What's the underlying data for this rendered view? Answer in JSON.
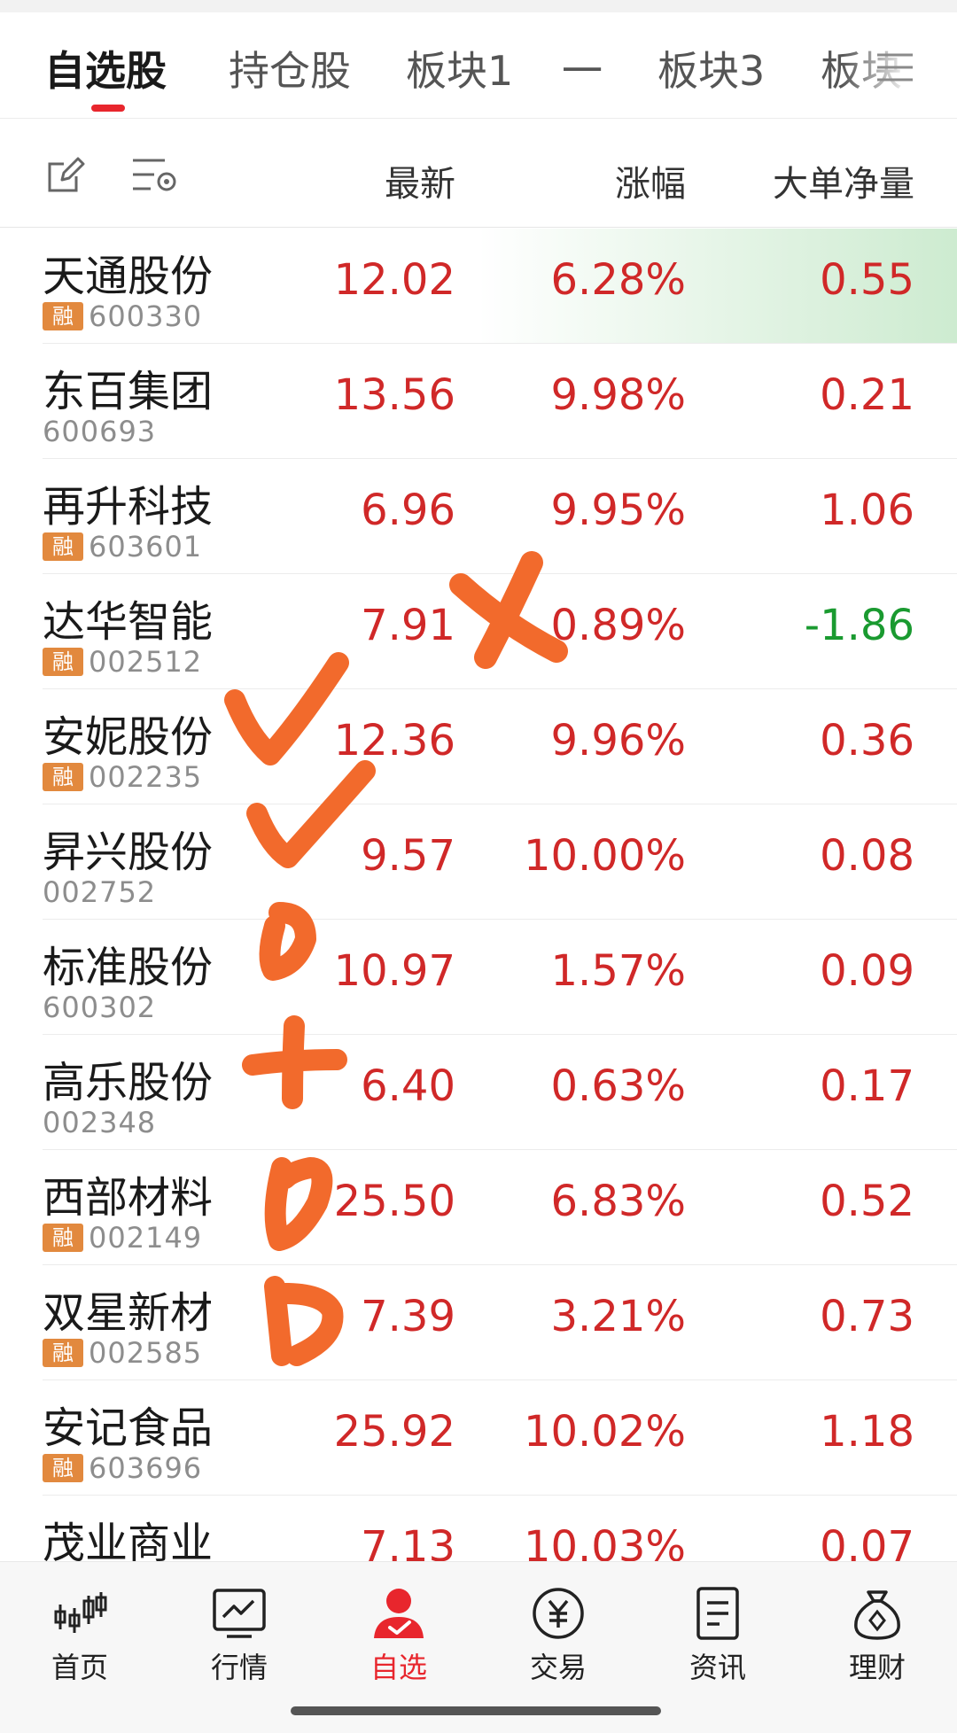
{
  "tabs": [
    {
      "label": "自选股",
      "active": true
    },
    {
      "label": "持仓股"
    },
    {
      "label": "板块1"
    },
    {
      "label": "一"
    },
    {
      "label": "板块3"
    },
    {
      "label": "板块"
    }
  ],
  "header": {
    "col_price": "最新",
    "col_change": "涨幅",
    "col_netflow": "大单净量"
  },
  "badge_label": "融",
  "stocks": [
    {
      "name": "天通股份",
      "code": "600330",
      "margin": true,
      "price": "12.02",
      "change": "6.28%",
      "netflow": "0.55",
      "highlighted": true
    },
    {
      "name": "东百集团",
      "code": "600693",
      "margin": false,
      "price": "13.56",
      "change": "9.98%",
      "netflow": "0.21"
    },
    {
      "name": "再升科技",
      "code": "603601",
      "margin": true,
      "price": "6.96",
      "change": "9.95%",
      "netflow": "1.06"
    },
    {
      "name": "达华智能",
      "code": "002512",
      "margin": true,
      "price": "7.91",
      "change": "0.89%",
      "netflow": "-1.86",
      "down": true
    },
    {
      "name": "安妮股份",
      "code": "002235",
      "margin": true,
      "price": "12.36",
      "change": "9.96%",
      "netflow": "0.36"
    },
    {
      "name": "昇兴股份",
      "code": "002752",
      "margin": false,
      "price": "9.57",
      "change": "10.00%",
      "netflow": "0.08"
    },
    {
      "name": "标准股份",
      "code": "600302",
      "margin": false,
      "price": "10.97",
      "change": "1.57%",
      "netflow": "0.09"
    },
    {
      "name": "高乐股份",
      "code": "002348",
      "margin": false,
      "price": "6.40",
      "change": "0.63%",
      "netflow": "0.17"
    },
    {
      "name": "西部材料",
      "code": "002149",
      "margin": true,
      "price": "25.50",
      "change": "6.83%",
      "netflow": "0.52"
    },
    {
      "name": "双星新材",
      "code": "002585",
      "margin": true,
      "price": "7.39",
      "change": "3.21%",
      "netflow": "0.73"
    },
    {
      "name": "安记食品",
      "code": "603696",
      "margin": true,
      "price": "25.92",
      "change": "10.02%",
      "netflow": "1.18"
    },
    {
      "name": "茂业商业",
      "code": "",
      "margin": false,
      "price": "7.13",
      "change": "10.03%",
      "netflow": "0.07"
    }
  ],
  "nav": [
    {
      "label": "首页",
      "icon": "candlestick-icon"
    },
    {
      "label": "行情",
      "icon": "market-chart-icon"
    },
    {
      "label": "自选",
      "icon": "user-check-icon",
      "active": true
    },
    {
      "label": "交易",
      "icon": "yen-coin-icon"
    },
    {
      "label": "资讯",
      "icon": "document-icon"
    },
    {
      "label": "理财",
      "icon": "money-bag-icon"
    }
  ],
  "colors": {
    "up": "#d02828",
    "down": "#1a9a30",
    "accent": "#e8262d",
    "badge": "#e2893e",
    "annotation": "#f26a2c"
  }
}
